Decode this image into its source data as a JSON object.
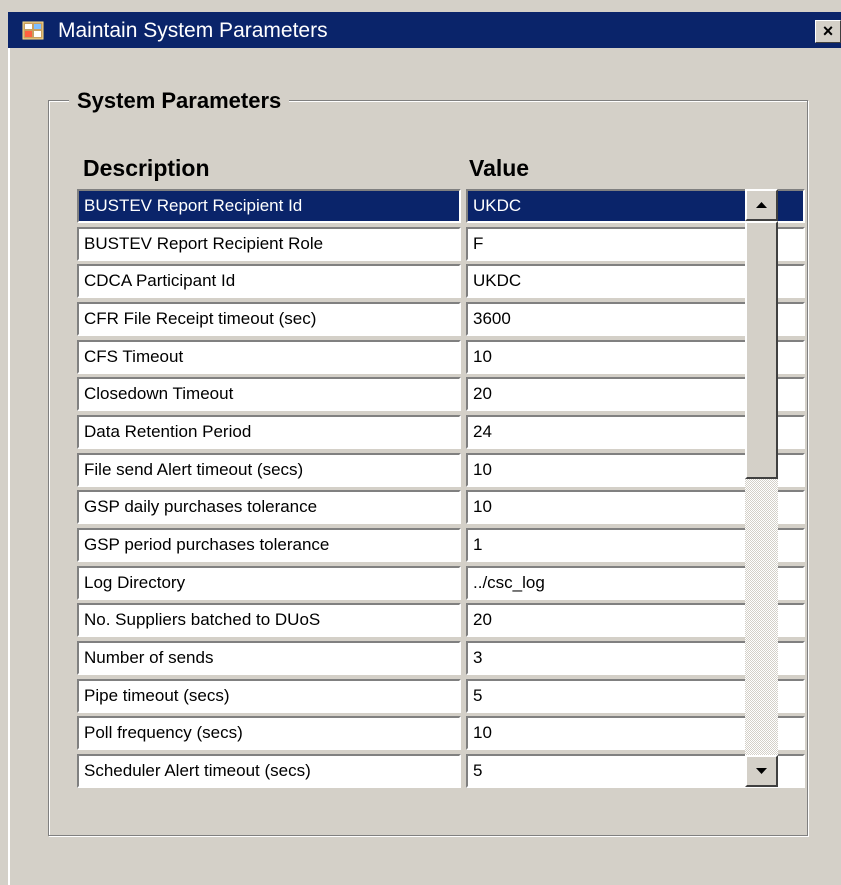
{
  "window": {
    "title": "Maintain System Parameters",
    "close_icon": "close-icon",
    "app_icon": "oracle-forms-icon",
    "titlebar_color": "#0a246a",
    "background_color": "#d4d0c8"
  },
  "group": {
    "title": "System Parameters"
  },
  "columns": {
    "description": "Description",
    "value": "Value"
  },
  "rows": [
    {
      "description": "BUSTEV Report Recipient Id",
      "value": "UKDC",
      "selected": true
    },
    {
      "description": "BUSTEV Report Recipient Role",
      "value": "F"
    },
    {
      "description": "CDCA Participant Id",
      "value": "UKDC"
    },
    {
      "description": "CFR File Receipt timeout (sec)",
      "value": "3600"
    },
    {
      "description": "CFS Timeout",
      "value": "10"
    },
    {
      "description": "Closedown Timeout",
      "value": "20"
    },
    {
      "description": "Data Retention Period",
      "value": "24"
    },
    {
      "description": "File send Alert timeout (secs)",
      "value": "10"
    },
    {
      "description": "GSP daily purchases tolerance",
      "value": "10"
    },
    {
      "description": "GSP period purchases tolerance",
      "value": "1"
    },
    {
      "description": "Log Directory",
      "value": "../csc_log"
    },
    {
      "description": "No. Suppliers batched to DUoS",
      "value": "20"
    },
    {
      "description": "Number of sends",
      "value": "3"
    },
    {
      "description": "Pipe timeout (secs)",
      "value": "5"
    },
    {
      "description": "Poll frequency (secs)",
      "value": "10"
    },
    {
      "description": "Scheduler Alert timeout (secs)",
      "value": "5"
    }
  ],
  "scrollbar": {
    "up_icon": "scroll-up-arrow-icon",
    "down_icon": "scroll-down-arrow-icon"
  }
}
